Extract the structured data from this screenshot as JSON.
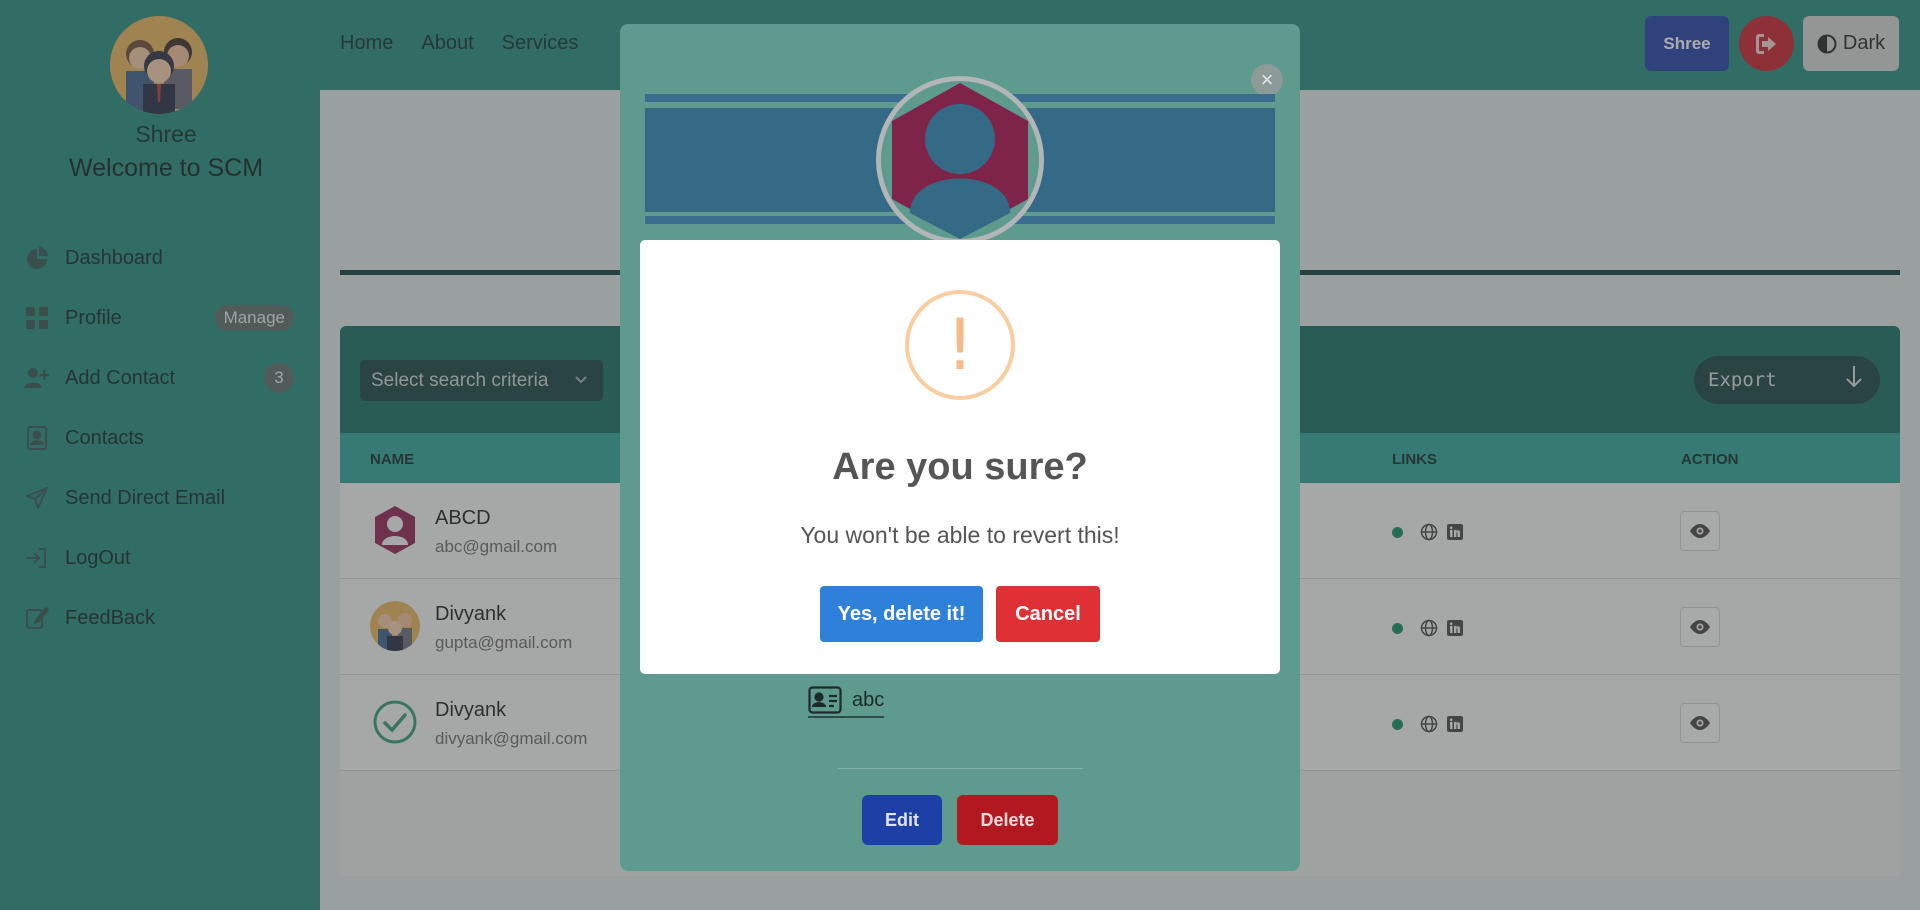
{
  "sidebar": {
    "user_name": "Shree",
    "welcome": "Welcome to SCM",
    "items": [
      {
        "label": "Dashboard",
        "icon": "dashboard-icon"
      },
      {
        "label": "Profile",
        "icon": "grid-icon",
        "badge": "Manage"
      },
      {
        "label": "Add Contact",
        "icon": "user-plus-icon",
        "badge": "3"
      },
      {
        "label": "Contacts",
        "icon": "contact-card-icon"
      },
      {
        "label": "Send Direct Email",
        "icon": "paper-plane-icon"
      },
      {
        "label": "LogOut",
        "icon": "logout-icon"
      },
      {
        "label": "FeedBack",
        "icon": "feedback-icon"
      }
    ]
  },
  "topbar": {
    "nav": [
      "Home",
      "About",
      "Services"
    ],
    "user_button": "Shree",
    "theme_button": "Dark"
  },
  "table": {
    "search_select": "Select search criteria",
    "export_label": "Export",
    "columns": {
      "name": "NAME",
      "links": "LINKS",
      "action": "ACTION"
    },
    "rows": [
      {
        "name": "ABCD",
        "email": "abc@gmail.com",
        "avatar": "default-avatar-icon"
      },
      {
        "name": "Divyank",
        "email": "gupta@gmail.com",
        "avatar": "group-avatar"
      },
      {
        "name": "Divyank",
        "email": "divyank@gmail.com",
        "avatar": "check-circle-icon"
      }
    ]
  },
  "contact_modal": {
    "card_text": "abc",
    "edit_label": "Edit",
    "delete_label": "Delete"
  },
  "alert": {
    "icon_glyph": "!",
    "title": "Are you sure?",
    "text": "You won't be able to revert this!",
    "confirm_label": "Yes, delete it!",
    "cancel_label": "Cancel"
  },
  "colors": {
    "accent": "#1f8c7e",
    "primary": "#1e3fa6",
    "danger": "#b2181f",
    "alert_confirm": "#2f80d8",
    "alert_cancel": "#df3035",
    "warning": "#f9cda2"
  }
}
